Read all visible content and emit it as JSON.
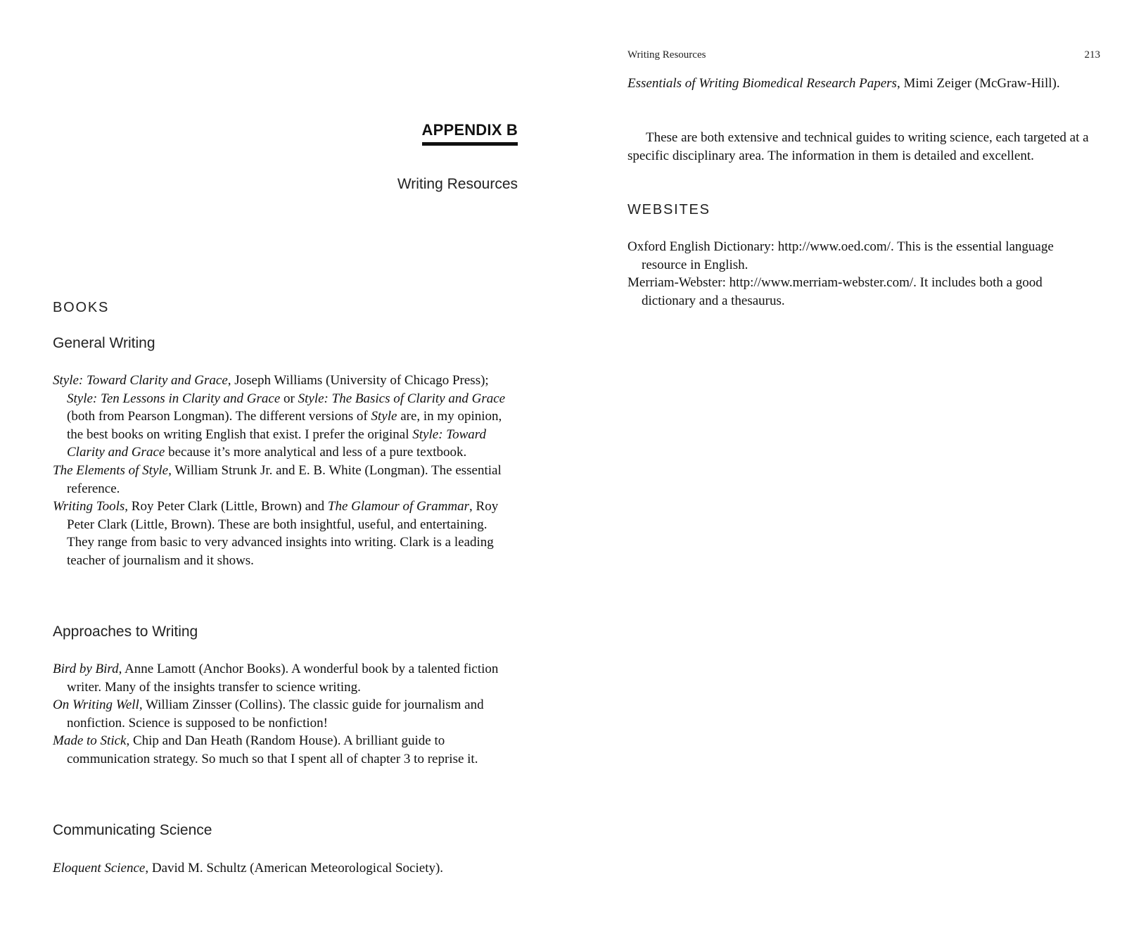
{
  "left_page": {
    "appendix_label": "APPENDIX B",
    "appendix_title": "Writing Resources",
    "books_heading": "BOOKS",
    "general_writing": {
      "heading": "General Writing",
      "entries": [
        {
          "t1": "Style: Toward Clarity and Grace",
          "t2": ", Joseph Williams (University of Chicago Press); ",
          "t3": "Style: Ten Lessons in Clarity and Grace",
          "t4": " or ",
          "t5": "Style: The Basics of Clarity and Grace",
          "t6": " (both from Pearson Longman). The different versions of ",
          "t7": "Style",
          "t8": " are, in my opinion, the best books on writing English that exist. I prefer the original ",
          "t9": "Style: Toward Clarity and Grace",
          "t10": " because it’s more analytical and less of a pure textbook."
        },
        {
          "t1": "The Elements of Style,",
          "t2": " William Strunk Jr. and E. B. White (Longman). The essential reference."
        },
        {
          "t1": "Writing Tools",
          "t2": ", Roy Peter Clark (Little, Brown) and ",
          "t3": "The Glamour of Grammar",
          "t4": ", Roy Peter Clark (Little, Brown). These are both insightful, useful, and entertaining. They range from basic to very advanced insights into writing. Clark is a leading teacher of journalism and it shows."
        }
      ]
    },
    "approaches": {
      "heading": "Approaches to Writing",
      "entries": [
        {
          "t1": "Bird by Bird",
          "t2": ", Anne Lamott (Anchor Books). A wonderful book by a talented fiction writer. Many of the insights transfer to science writing."
        },
        {
          "t1": "On Writing Well",
          "t2": ", William Zinsser (Collins). The classic guide for journalism and nonfiction. Science is supposed to be nonfiction!"
        },
        {
          "t1": "Made to Stick",
          "t2": ", Chip and Dan Heath (Random House). A brilliant guide to communication strategy. So much so that I spent all of chapter 3 to reprise it."
        }
      ]
    },
    "communicating": {
      "heading": "Communicating Science",
      "entries": [
        {
          "t1": "Eloquent Science",
          "t2": ", David M. Schultz (American Meteorological Society)."
        }
      ]
    }
  },
  "right_page": {
    "running_head": "Writing Resources",
    "page_number": "213",
    "entries": [
      {
        "t1": "Essentials of Writing Biomedical Research Papers",
        "t2": ", Mimi Zeiger (McGraw-Hill)."
      }
    ],
    "paragraph": "These are both extensive and technical guides to writing science, each targeted at a specific disciplinary area. The information in them is detailed and excellent.",
    "websites_heading": "WEBSITES",
    "websites": [
      {
        "text": "Oxford English Dictionary: http://www.oed.com/. This is the essential language resource in English."
      },
      {
        "text": "Merriam-Webster: http://www.merriam-webster.com/. It includes both a good dictionary and a thesaurus."
      }
    ]
  }
}
